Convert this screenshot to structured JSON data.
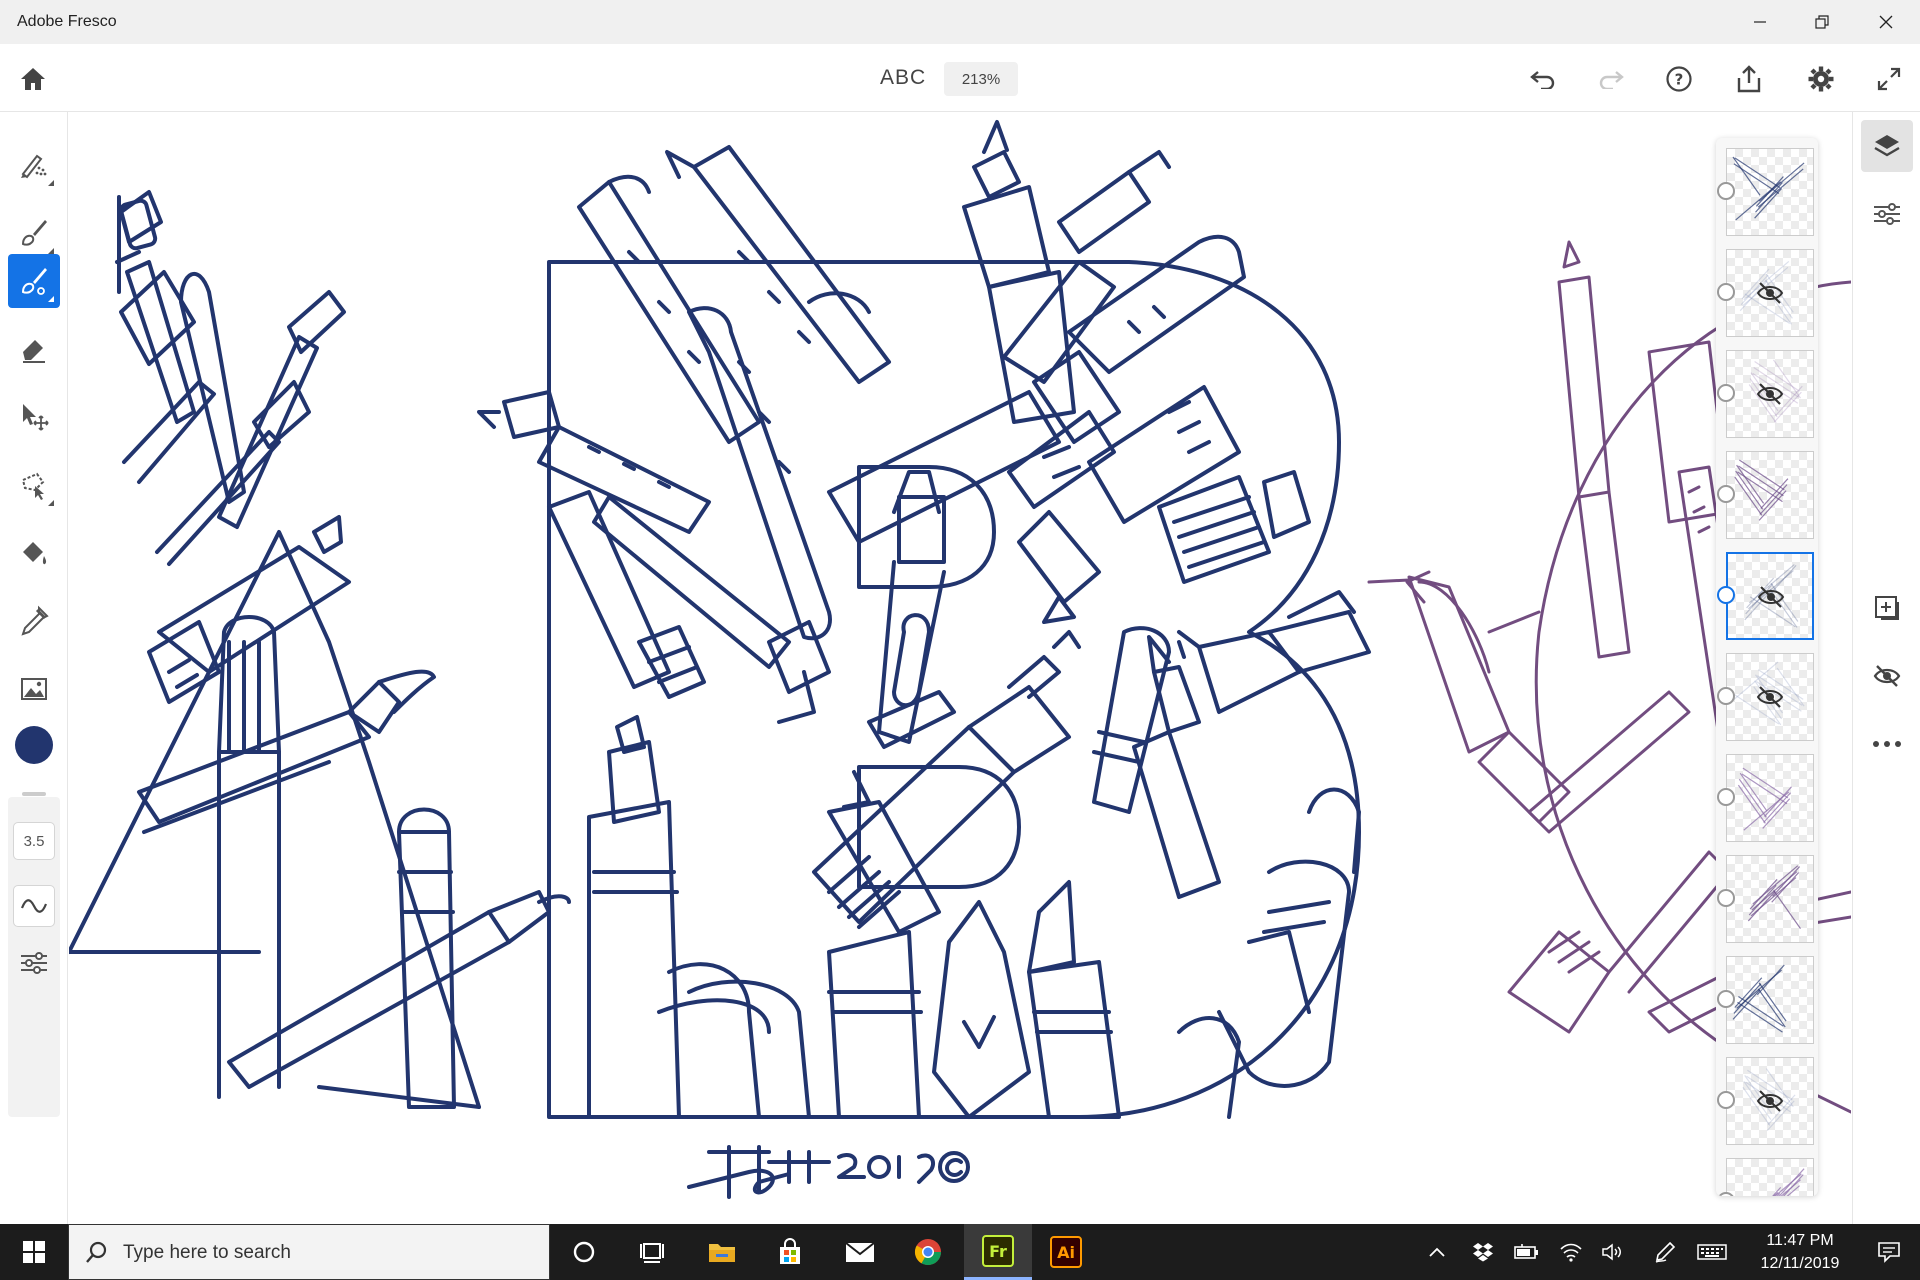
{
  "window": {
    "title": "Adobe Fresco",
    "controls": [
      "minimize",
      "restore",
      "close"
    ]
  },
  "toolbar": {
    "document_name": "ABC",
    "zoom": "213%",
    "buttons": [
      "home-icon",
      "undo-icon",
      "redo-icon",
      "help-icon",
      "share-icon",
      "settings-icon",
      "fullscreen-icon"
    ]
  },
  "tools": {
    "items": [
      {
        "name": "live-brush",
        "icon": "live-brush-icon"
      },
      {
        "name": "pixel-brush",
        "icon": "pixel-brush-icon"
      },
      {
        "name": "vector-brush",
        "icon": "vector-brush-icon",
        "active": true
      },
      {
        "name": "eraser",
        "icon": "eraser-icon"
      },
      {
        "name": "transform",
        "icon": "move-icon"
      },
      {
        "name": "lasso",
        "icon": "lasso-icon"
      },
      {
        "name": "fill",
        "icon": "paint-bucket-icon"
      },
      {
        "name": "eyedropper",
        "icon": "eyedropper-icon"
      },
      {
        "name": "place-image",
        "icon": "image-icon"
      }
    ],
    "color": "#22356e",
    "brush_size": "3.5"
  },
  "layers": {
    "count_visible_thumbnails": 11,
    "selected_index": 4,
    "hidden_indices": [
      1,
      2,
      4,
      5,
      9
    ]
  },
  "right_rail": {
    "buttons": [
      "layers-icon",
      "layer-properties-icon",
      "add-layer-icon",
      "hide-layer-icon",
      "more-icon"
    ]
  },
  "colors": {
    "accent": "#1473e6",
    "ink": "#22356e",
    "sketch": "#5a2e6b"
  },
  "taskbar": {
    "search_placeholder": "Type here to search",
    "apps": [
      "task-view-icon",
      "file-explorer-icon",
      "store-icon",
      "mail-icon",
      "chrome-icon",
      "fresco-icon",
      "illustrator-icon"
    ],
    "fresco_label": "Fr",
    "illustrator_label": "Ai",
    "time": "11:47 PM",
    "date": "12/11/2019"
  }
}
